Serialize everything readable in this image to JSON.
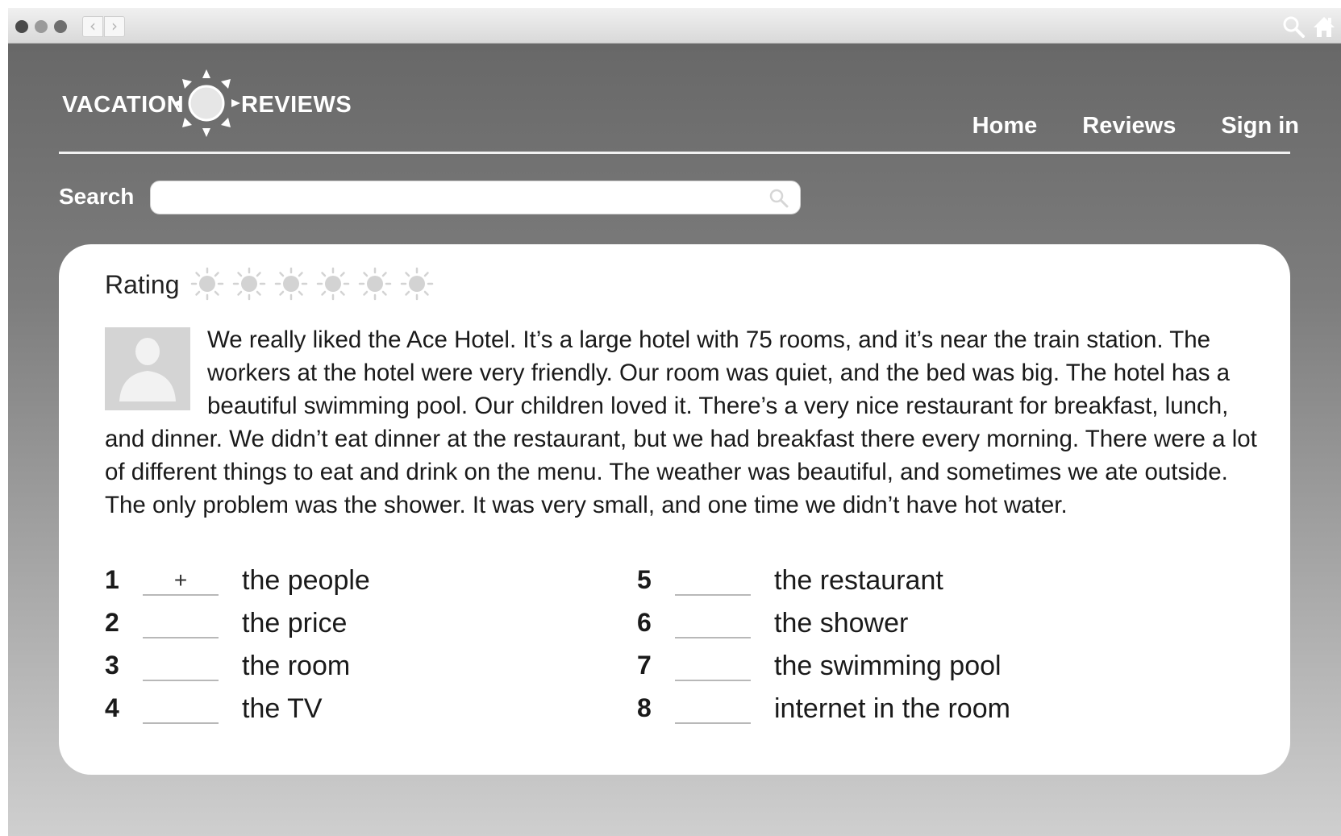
{
  "browser": {
    "back_icon": "‹",
    "forward_icon": "›",
    "search_icon": "magnifier-icon",
    "home_icon": "home-icon"
  },
  "site": {
    "logo_left": "VACATION",
    "logo_right": "REVIEWS",
    "logo_icon": "sun-icon"
  },
  "nav": {
    "home": "Home",
    "reviews": "Reviews",
    "sign_in": "Sign in"
  },
  "search": {
    "label": "Search",
    "value": "",
    "placeholder": ""
  },
  "review": {
    "rating_label": "Rating",
    "rating_value": 0,
    "rating_max": 6,
    "text": "We really liked the Ace Hotel. It’s a large hotel with 75 rooms, and it’s near the train station. The workers at the hotel were very friendly. Our room was quiet, and the bed was big. The hotel has a beautiful swimming pool. Our children loved it. There’s a very nice restaurant for breakfast, lunch, and dinner. We didn’t eat dinner at the restaurant, but we had breakfast there every morning. There were a lot of different things to eat and drink on the menu. The weather was beautiful, and sometimes we ate outside. The only problem was the shower. It was very small, and one time we didn’t have hot water."
  },
  "exercise": {
    "items": [
      {
        "num": "1",
        "answer": "+",
        "label": "the people"
      },
      {
        "num": "2",
        "answer": "",
        "label": "the price"
      },
      {
        "num": "3",
        "answer": "",
        "label": "the room"
      },
      {
        "num": "4",
        "answer": "",
        "label": "the TV"
      },
      {
        "num": "5",
        "answer": "",
        "label": "the restaurant"
      },
      {
        "num": "6",
        "answer": "",
        "label": "the shower"
      },
      {
        "num": "7",
        "answer": "",
        "label": "the swimming pool"
      },
      {
        "num": "8",
        "answer": "",
        "label": "internet in the room"
      }
    ]
  },
  "colors": {
    "header_bg_top": "#656565",
    "header_bg_bottom": "#cfcfcf",
    "star_fill": "#d3d3d3"
  }
}
